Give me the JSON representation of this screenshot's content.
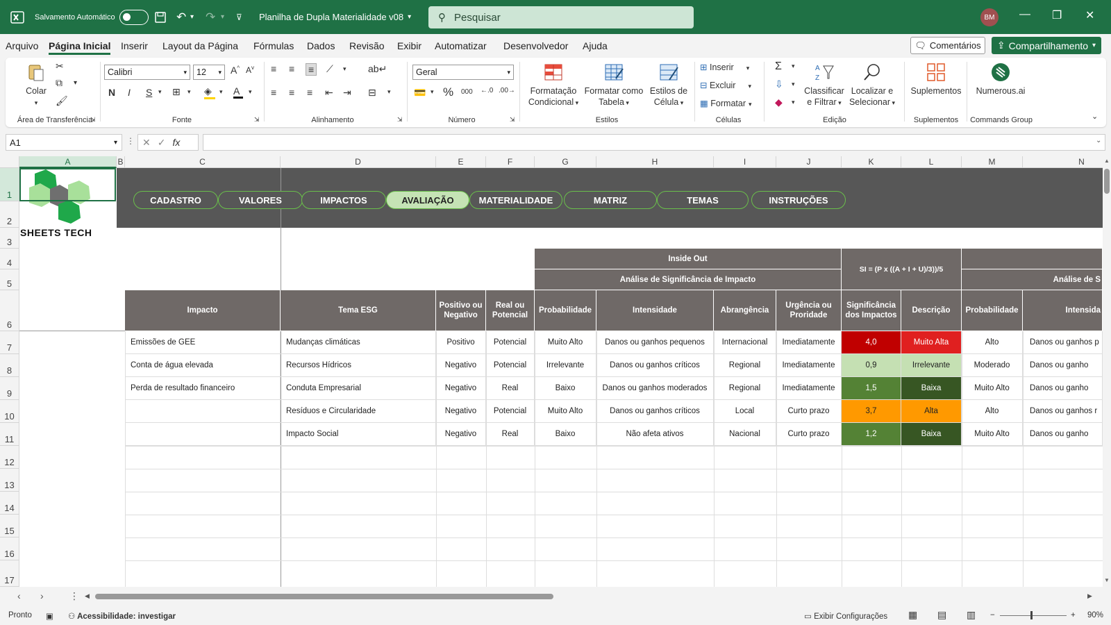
{
  "titlebar": {
    "autosave_label": "Salvamento Automático",
    "doc_title": "Planilha de Dupla Materialidade v08",
    "search_placeholder": "Pesquisar",
    "avatar_initials": "BM"
  },
  "menu": {
    "items": [
      "Arquivo",
      "Página Inicial",
      "Inserir",
      "Layout da Página",
      "Fórmulas",
      "Dados",
      "Revisão",
      "Exibir",
      "Automatizar",
      "Desenvolvedor",
      "Ajuda"
    ],
    "active": "Página Inicial",
    "comments": "Comentários",
    "share": "Compartilhamento"
  },
  "ribbon": {
    "clipboard": {
      "paste": "Colar",
      "group": "Área de Transferência"
    },
    "font": {
      "name": "Calibri",
      "size": "12",
      "group": "Fonte",
      "bold": "N",
      "italic": "I",
      "underline": "S"
    },
    "alignment": {
      "group": "Alinhamento"
    },
    "number": {
      "format": "Geral",
      "group": "Número"
    },
    "styles": {
      "cond_format_1": "Formatação",
      "cond_format_2": "Condicional",
      "format_table_1": "Formatar como",
      "format_table_2": "Tabela",
      "cell_styles_1": "Estilos de",
      "cell_styles_2": "Célula",
      "group": "Estilos"
    },
    "cells": {
      "insert": "Inserir",
      "delete": "Excluir",
      "format": "Formatar",
      "group": "Células"
    },
    "editing": {
      "sort_1": "Classificar",
      "sort_2": "e Filtrar",
      "find_1": "Localizar e",
      "find_2": "Selecionar",
      "group": "Edição"
    },
    "addins": {
      "label": "Suplementos",
      "group": "Suplementos"
    },
    "commands": {
      "label": "Numerous.ai",
      "group": "Commands Group"
    }
  },
  "formula_bar": {
    "name_box": "A1",
    "fx": "fx",
    "formula": ""
  },
  "columns": [
    "A",
    "B",
    "C",
    "D",
    "E",
    "F",
    "G",
    "H",
    "I",
    "J",
    "K",
    "L",
    "M",
    "N"
  ],
  "rows": [
    "1",
    "2",
    "3",
    "4",
    "5",
    "6",
    "7",
    "8",
    "9",
    "10",
    "11",
    "12",
    "13",
    "14",
    "15",
    "16",
    "17"
  ],
  "logo_text": "SHEETS TECH",
  "nav_tabs": [
    "CADASTRO",
    "VALORES",
    "IMPACTOS",
    "AVALIAÇÃO",
    "MATERIALIDADE",
    "MATRIZ",
    "TEMAS",
    "INSTRUÇÕES"
  ],
  "nav_active": "AVALIAÇÃO",
  "table": {
    "inside_out": "Inside Out",
    "analysis_title": "Análise de Significância de Impacto",
    "formula_label": "SI = (P x ((A + I + U)/3))/5",
    "analysis_title_2": "Análise de S",
    "headers": {
      "impacto": "Impacto",
      "tema": "Tema ESG",
      "pos_neg": "Positivo ou Negativo",
      "real_pot": "Real ou Potencial",
      "prob": "Probabilidade",
      "intens": "Intensidade",
      "abrang": "Abrangência",
      "urg": "Urgência ou Proridade",
      "signif": "Significância dos Impactos",
      "desc": "Descrição",
      "prob2": "Probabilidade",
      "intens2": "Intensida"
    },
    "rows": [
      {
        "impacto": "Emissões de GEE",
        "tema": "Mudanças climáticas",
        "pos_neg": "Positivo",
        "real_pot": "Potencial",
        "prob": "Muito Alto",
        "intens": "Danos ou ganhos pequenos",
        "abrang": "Internacional",
        "urg": "Imediatamente",
        "signif": "4,0",
        "desc": "Muito Alta",
        "prob2": "Alto",
        "intens2": "Danos ou ganhos p"
      },
      {
        "impacto": "Conta de água elevada",
        "tema": "Recursos Hídricos",
        "pos_neg": "Negativo",
        "real_pot": "Potencial",
        "prob": "Irrelevante",
        "intens": "Danos ou ganhos críticos",
        "abrang": "Regional",
        "urg": "Imediatamente",
        "signif": "0,9",
        "desc": "Irrelevante",
        "prob2": "Moderado",
        "intens2": "Danos ou ganho"
      },
      {
        "impacto": "Perda de resultado financeiro",
        "tema": "Conduta Empresarial",
        "pos_neg": "Negativo",
        "real_pot": "Real",
        "prob": "Baixo",
        "intens": "Danos ou ganhos moderados",
        "abrang": "Regional",
        "urg": "Imediatamente",
        "signif": "1,5",
        "desc": "Baixa",
        "prob2": "Muito Alto",
        "intens2": "Danos ou ganho"
      },
      {
        "impacto": "",
        "tema": "Resíduos e Circularidade",
        "pos_neg": "Negativo",
        "real_pot": "Potencial",
        "prob": "Muito Alto",
        "intens": "Danos ou ganhos críticos",
        "abrang": "Local",
        "urg": "Curto prazo",
        "signif": "3,7",
        "desc": "Alta",
        "prob2": "Alto",
        "intens2": "Danos ou ganhos r"
      },
      {
        "impacto": "",
        "tema": "Impacto Social",
        "pos_neg": "Negativo",
        "real_pot": "Real",
        "prob": "Baixo",
        "intens": "Não afeta ativos",
        "abrang": "Nacional",
        "urg": "Curto prazo",
        "signif": "1,2",
        "desc": "Baixa",
        "prob2": "Muito Alto",
        "intens2": "Danos ou ganho"
      }
    ],
    "colors": {
      "signif": [
        "#c00000",
        "#c5e0b3",
        "#548235",
        "#ff9900",
        "#548235"
      ],
      "desc": [
        "#e02020",
        "#c5e0b3",
        "#375623",
        "#ff9900",
        "#375623"
      ],
      "signif_text": [
        "#ffffff",
        "#222222",
        "#ffffff",
        "#222222",
        "#ffffff"
      ]
    }
  },
  "status": {
    "ready": "Pronto",
    "accessibility": "Acessibilidade: investigar",
    "display_settings": "Exibir Configurações",
    "zoom": "90%"
  }
}
